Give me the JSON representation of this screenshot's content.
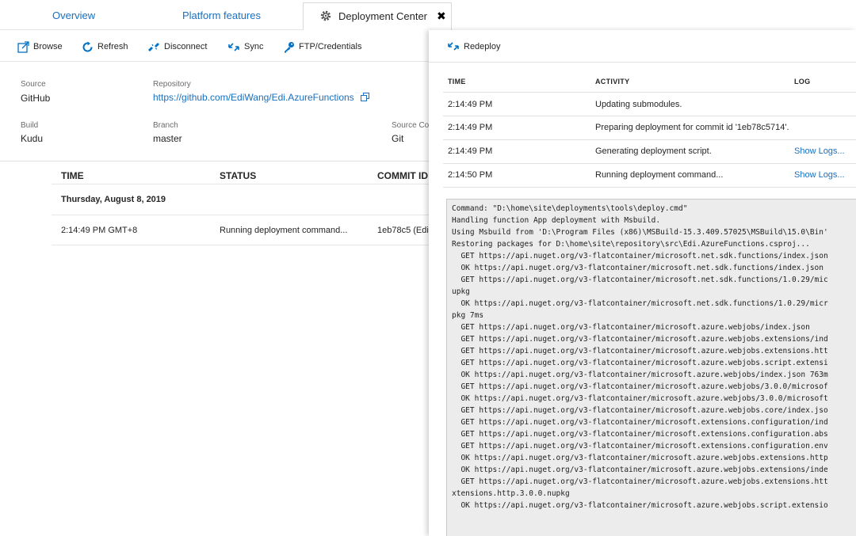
{
  "tabs": {
    "overview": "Overview",
    "platform_features": "Platform features",
    "deployment_center": "Deployment Center",
    "close_glyph": "✖"
  },
  "toolbar": {
    "browse": "Browse",
    "refresh": "Refresh",
    "disconnect": "Disconnect",
    "sync": "Sync",
    "ftp": "FTP/Credentials"
  },
  "info": {
    "source_label": "Source",
    "source_value": "GitHub",
    "repository_label": "Repository",
    "repository_value": "https://github.com/EdiWang/Edi.AzureFunctions",
    "build_label": "Build",
    "build_value": "Kudu",
    "branch_label": "Branch",
    "branch_value": "master",
    "source_control_label": "Source Co",
    "source_control_value": "Git"
  },
  "deployments": {
    "headers": {
      "time": "TIME",
      "status": "STATUS",
      "commit": "COMMIT ID"
    },
    "group": "Thursday, August 8, 2019",
    "rows": [
      {
        "time": "2:14:49 PM GMT+8",
        "status": "Running deployment command...",
        "commit": "1eb78c5 (Edi"
      }
    ]
  },
  "panel": {
    "redeploy": "Redeploy",
    "headers": {
      "time": "TIME",
      "activity": "ACTIVITY",
      "log": "LOG"
    },
    "rows": [
      {
        "time": "2:14:49 PM",
        "activity": "Updating submodules.",
        "log": ""
      },
      {
        "time": "2:14:49 PM",
        "activity": "Preparing deployment for commit id '1eb78c5714'.",
        "log": ""
      },
      {
        "time": "2:14:49 PM",
        "activity": "Generating deployment script.",
        "log": "Show Logs..."
      },
      {
        "time": "2:14:50 PM",
        "activity": "Running deployment command...",
        "log": "Show Logs..."
      }
    ],
    "log_lines": [
      "Command: \"D:\\home\\site\\deployments\\tools\\deploy.cmd\"",
      "Handling function App deployment with Msbuild.",
      "Using Msbuild from 'D:\\Program Files (x86)\\MSBuild-15.3.409.57025\\MSBuild\\15.0\\Bin'",
      "Restoring packages for D:\\home\\site\\repository\\src\\Edi.AzureFunctions.csproj...",
      "  GET https://api.nuget.org/v3-flatcontainer/microsoft.net.sdk.functions/index.json",
      "  OK https://api.nuget.org/v3-flatcontainer/microsoft.net.sdk.functions/index.json",
      "  GET https://api.nuget.org/v3-flatcontainer/microsoft.net.sdk.functions/1.0.29/mic",
      "upkg",
      "  OK https://api.nuget.org/v3-flatcontainer/microsoft.net.sdk.functions/1.0.29/micr",
      "pkg 7ms",
      "  GET https://api.nuget.org/v3-flatcontainer/microsoft.azure.webjobs/index.json",
      "  GET https://api.nuget.org/v3-flatcontainer/microsoft.azure.webjobs.extensions/ind",
      "  GET https://api.nuget.org/v3-flatcontainer/microsoft.azure.webjobs.extensions.htt",
      "  GET https://api.nuget.org/v3-flatcontainer/microsoft.azure.webjobs.script.extensi",
      "  OK https://api.nuget.org/v3-flatcontainer/microsoft.azure.webjobs/index.json 763m",
      "  GET https://api.nuget.org/v3-flatcontainer/microsoft.azure.webjobs/3.0.0/microsof",
      "  OK https://api.nuget.org/v3-flatcontainer/microsoft.azure.webjobs/3.0.0/microsoft",
      "  GET https://api.nuget.org/v3-flatcontainer/microsoft.azure.webjobs.core/index.jso",
      "  GET https://api.nuget.org/v3-flatcontainer/microsoft.extensions.configuration/ind",
      "  GET https://api.nuget.org/v3-flatcontainer/microsoft.extensions.configuration.abs",
      "  GET https://api.nuget.org/v3-flatcontainer/microsoft.extensions.configuration.env",
      "  OK https://api.nuget.org/v3-flatcontainer/microsoft.azure.webjobs.extensions.http",
      "  OK https://api.nuget.org/v3-flatcontainer/microsoft.azure.webjobs.extensions/inde",
      "  GET https://api.nuget.org/v3-flatcontainer/microsoft.azure.webjobs.extensions.htt",
      "xtensions.http.3.0.0.nupkg",
      "  OK https://api.nuget.org/v3-flatcontainer/microsoft.azure.webjobs.script.extensio"
    ]
  },
  "colors": {
    "link": "#1a6fbf",
    "accent_icon": "#0072c6"
  }
}
